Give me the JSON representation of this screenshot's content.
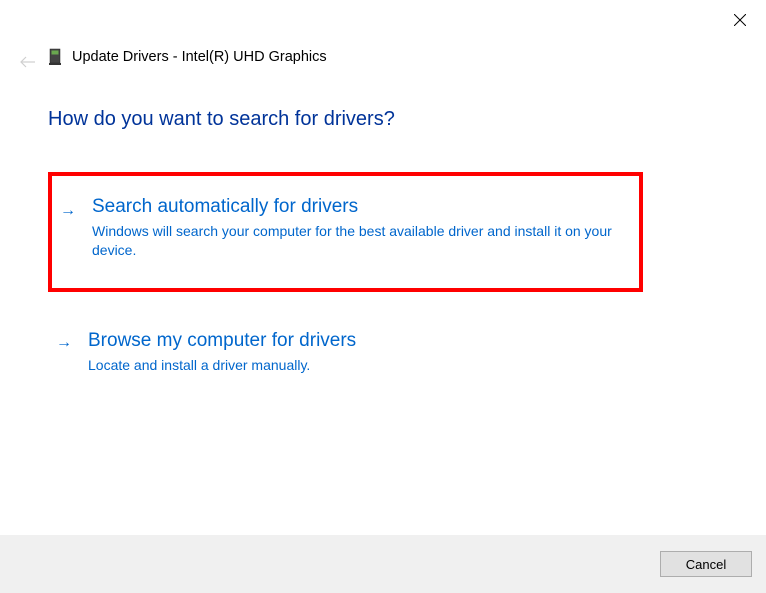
{
  "header": {
    "title": "Update Drivers - Intel(R) UHD Graphics"
  },
  "heading": "How do you want to search for drivers?",
  "options": {
    "auto": {
      "title": "Search automatically for drivers",
      "desc": "Windows will search your computer for the best available driver and install it on your device."
    },
    "browse": {
      "title": "Browse my computer for drivers",
      "desc": "Locate and install a driver manually."
    }
  },
  "footer": {
    "cancel": "Cancel"
  }
}
